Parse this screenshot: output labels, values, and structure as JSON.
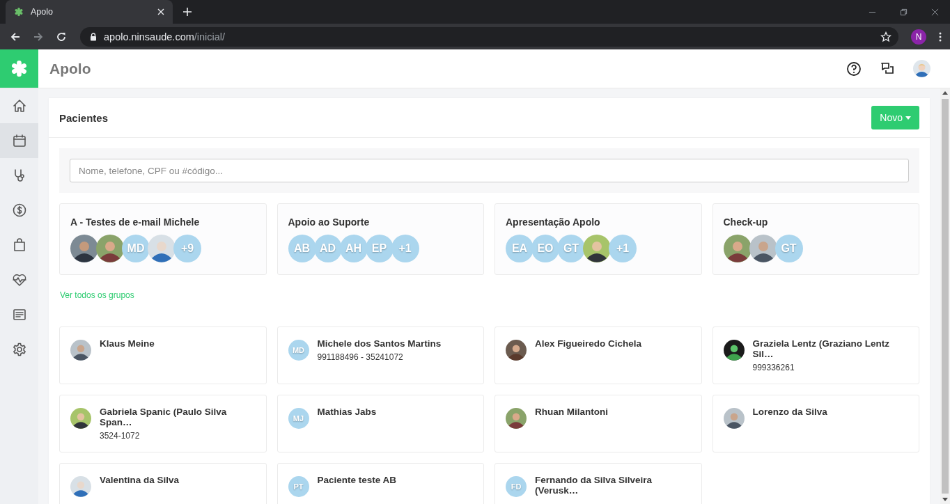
{
  "browser": {
    "tab_title": "Apolo",
    "url_host": "apolo.ninsaude.com",
    "url_path": "/inicial/",
    "profile_initial": "N"
  },
  "app": {
    "title": "Apolo"
  },
  "sidebar": {
    "items": [
      {
        "selected": false
      },
      {
        "selected": true
      },
      {
        "selected": false
      },
      {
        "selected": false
      },
      {
        "selected": false
      },
      {
        "selected": false
      },
      {
        "selected": false
      },
      {
        "selected": false
      }
    ]
  },
  "page": {
    "title": "Pacientes",
    "new_button": "Novo"
  },
  "search": {
    "placeholder": "Nome, telefone, CPF ou #código..."
  },
  "groups": [
    {
      "name": "A - Testes de e-mail Michele",
      "members": [
        {
          "kind": "picture"
        },
        {
          "kind": "picture"
        },
        {
          "kind": "initials",
          "text": "MD"
        },
        {
          "kind": "picture"
        },
        {
          "kind": "initials",
          "text": "+9"
        }
      ]
    },
    {
      "name": "Apoio ao Suporte",
      "members": [
        {
          "kind": "initials",
          "text": "AB"
        },
        {
          "kind": "initials",
          "text": "AD"
        },
        {
          "kind": "initials",
          "text": "AH"
        },
        {
          "kind": "initials",
          "text": "EP"
        },
        {
          "kind": "initials",
          "text": "+1"
        }
      ]
    },
    {
      "name": "Apresentação Apolo",
      "members": [
        {
          "kind": "initials",
          "text": "EA"
        },
        {
          "kind": "initials",
          "text": "EO"
        },
        {
          "kind": "initials",
          "text": "GT"
        },
        {
          "kind": "picture"
        },
        {
          "kind": "initials",
          "text": "+1"
        }
      ]
    },
    {
      "name": "Check-up",
      "members": [
        {
          "kind": "picture"
        },
        {
          "kind": "picture"
        },
        {
          "kind": "initials",
          "text": "GT"
        }
      ]
    }
  ],
  "groups_link": "Ver todos os grupos",
  "patients": [
    {
      "name": "Klaus Meine",
      "avatar": {
        "kind": "picture"
      }
    },
    {
      "name": "Michele dos Santos Martins",
      "phone": "991188496 - 35241072",
      "avatar": {
        "kind": "initials",
        "text": "MD"
      }
    },
    {
      "name": "Alex Figueiredo Cichela",
      "avatar": {
        "kind": "picture"
      }
    },
    {
      "name": "Graziela Lentz (Graziano Lentz Sil…",
      "phone": "999336261",
      "avatar": {
        "kind": "picture"
      }
    },
    {
      "name": "Gabriela Spanic (Paulo Silva Span…",
      "phone": "3524-1072",
      "avatar": {
        "kind": "picture"
      }
    },
    {
      "name": "Mathias Jabs",
      "avatar": {
        "kind": "initials",
        "text": "MJ"
      }
    },
    {
      "name": "Rhuan Milantoni",
      "avatar": {
        "kind": "picture"
      }
    },
    {
      "name": "Lorenzo da Silva",
      "avatar": {
        "kind": "picture"
      }
    },
    {
      "name": "Valentina da Silva",
      "avatar": {
        "kind": "picture"
      }
    },
    {
      "name": "Paciente teste AB",
      "avatar": {
        "kind": "initials",
        "text": "PT"
      }
    },
    {
      "name": "Fernando da Silva Silveira (Verusk…",
      "avatar": {
        "kind": "initials",
        "text": "FD"
      }
    }
  ]
}
